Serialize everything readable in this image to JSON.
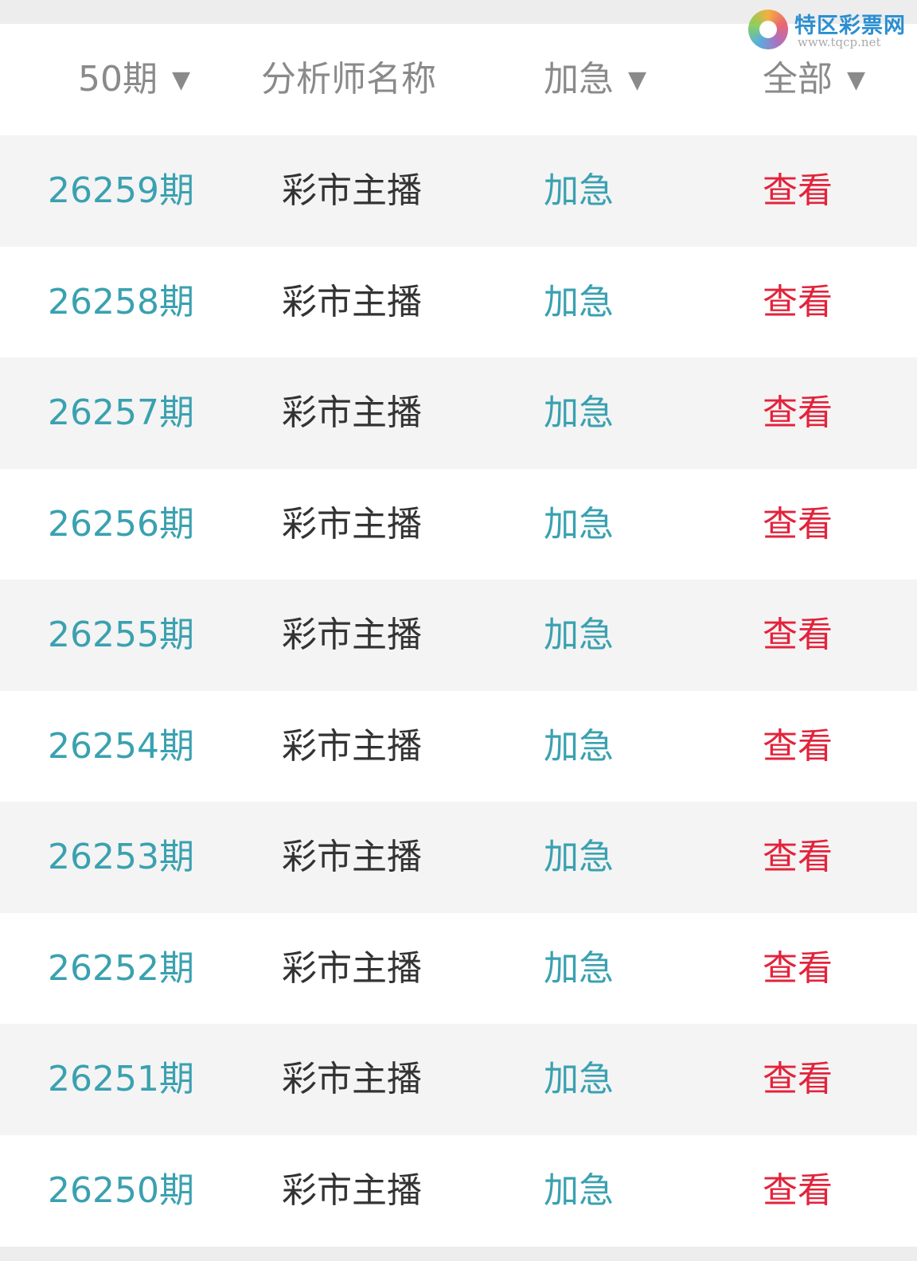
{
  "header": {
    "columns": [
      {
        "label": "50期",
        "arrow": "▼"
      },
      {
        "label": "分析师名称"
      },
      {
        "label": "加急",
        "arrow": "▼"
      },
      {
        "label": "全部",
        "arrow": "▼"
      }
    ]
  },
  "logo": {
    "brand": "特区彩票网",
    "url": "www.tqcp.net"
  },
  "rows": [
    {
      "period": "26259期",
      "name": "彩市主播",
      "urgent": "加急",
      "view": "查看"
    },
    {
      "period": "26258期",
      "name": "彩市主播",
      "urgent": "加急",
      "view": "查看"
    },
    {
      "period": "26257期",
      "name": "彩市主播",
      "urgent": "加急",
      "view": "查看"
    },
    {
      "period": "26256期",
      "name": "彩市主播",
      "urgent": "加急",
      "view": "查看"
    },
    {
      "period": "26255期",
      "name": "彩市主播",
      "urgent": "加急",
      "view": "查看"
    },
    {
      "period": "26254期",
      "name": "彩市主播",
      "urgent": "加急",
      "view": "查看"
    },
    {
      "period": "26253期",
      "name": "彩市主播",
      "urgent": "加急",
      "view": "查看"
    },
    {
      "period": "26252期",
      "name": "彩市主播",
      "urgent": "加急",
      "view": "查看"
    },
    {
      "period": "26251期",
      "name": "彩市主播",
      "urgent": "加急",
      "view": "查看"
    },
    {
      "period": "26250期",
      "name": "彩市主播",
      "urgent": "加急",
      "view": "查看"
    }
  ],
  "colors": {
    "accent": "#3aa1b0",
    "view": "#e3233b",
    "text": "#333333",
    "header_text": "#8a8a8a",
    "row_alt": "#f4f4f4"
  }
}
